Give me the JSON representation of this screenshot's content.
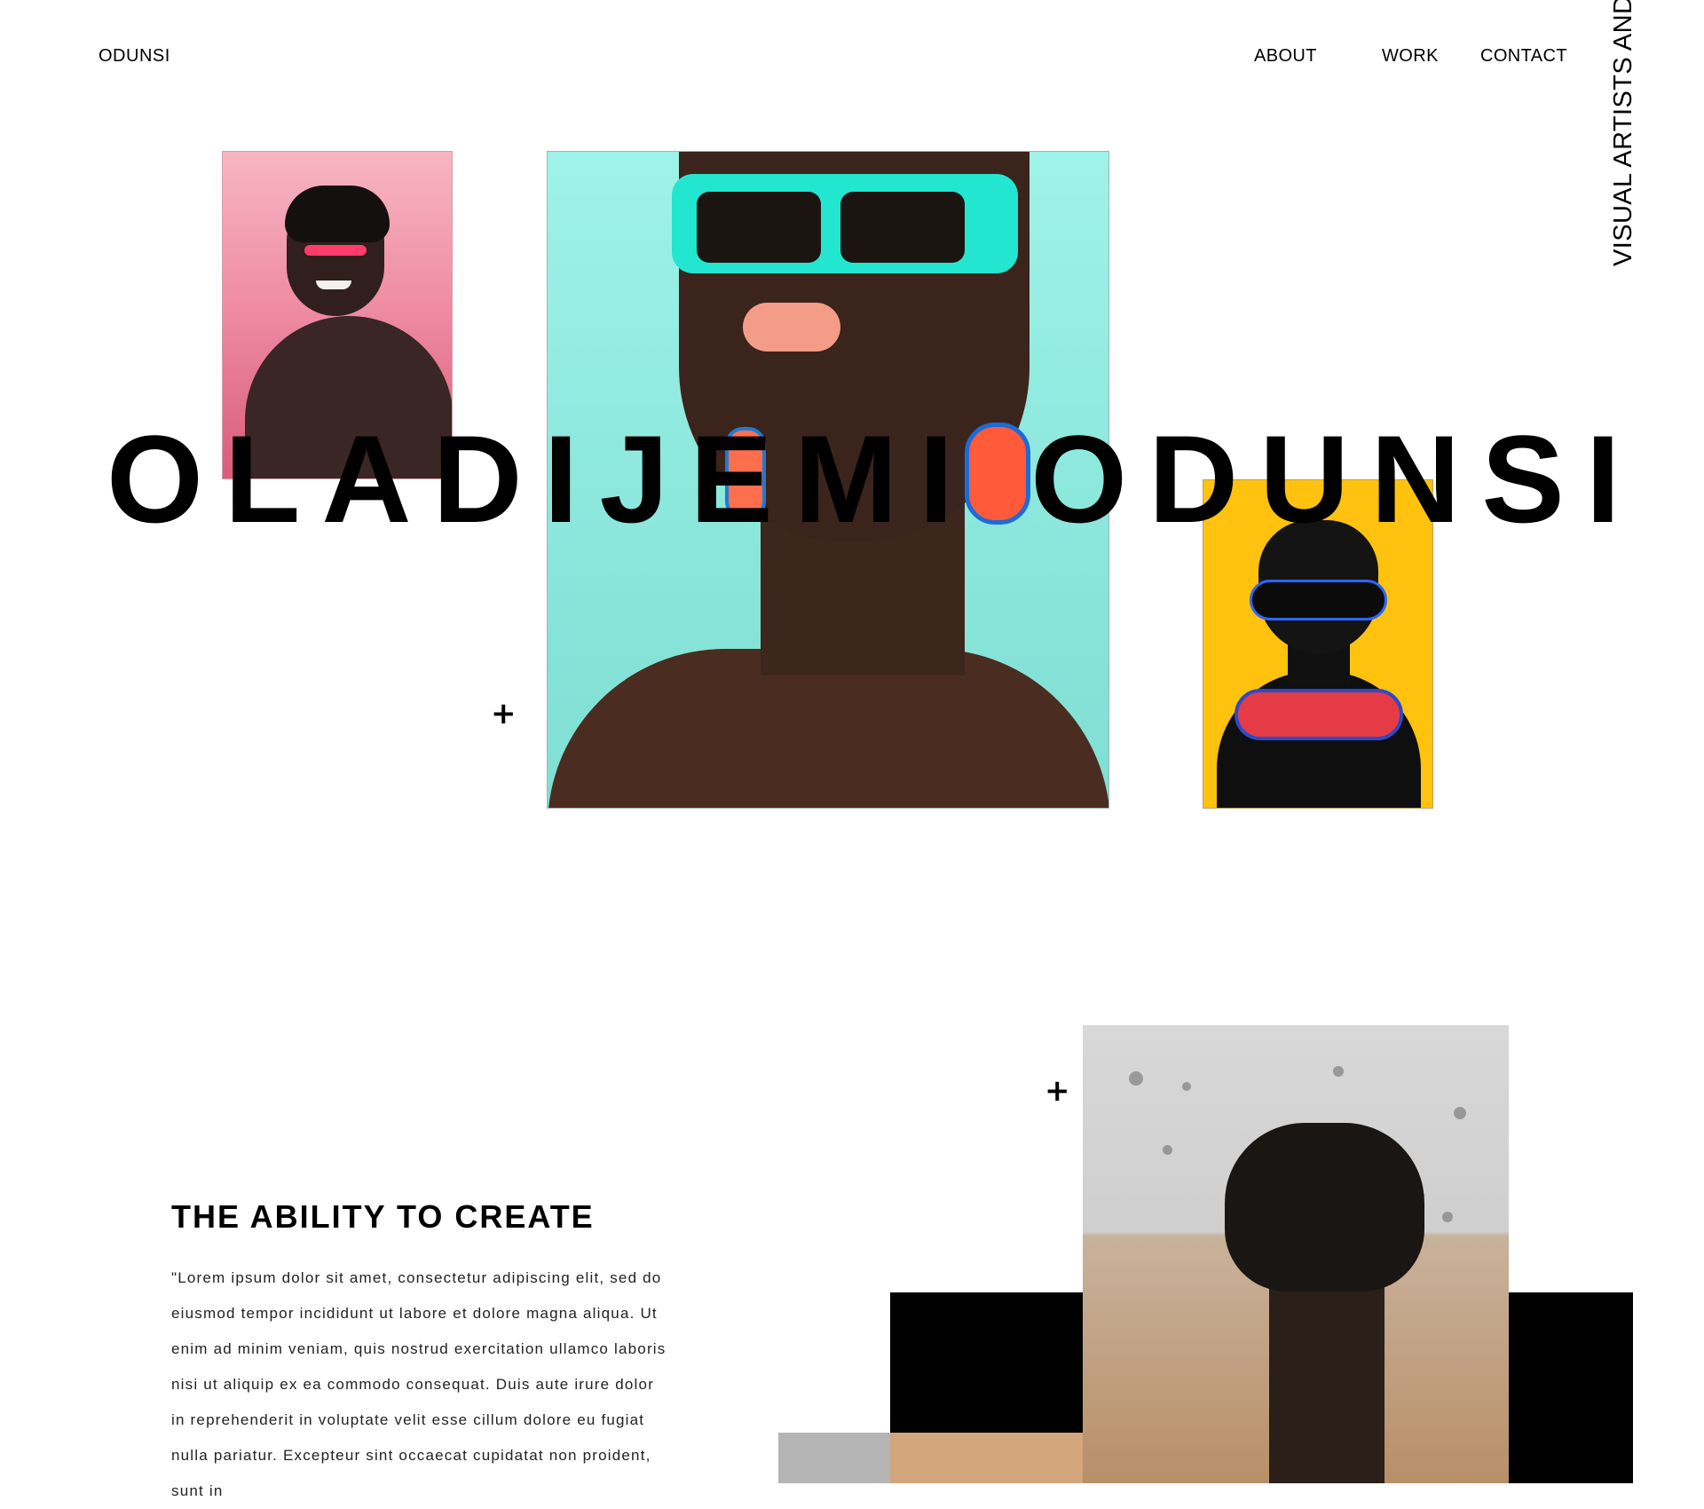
{
  "brand": "ODUNSI",
  "nav": {
    "about": "ABOUT",
    "work": "WORK",
    "contact": "CONTACT"
  },
  "hero": {
    "name": "OLADIJEMI ODUNSI",
    "tagline": "VISUAL ARTISTS AND PHOTOGRAPHER",
    "plus": "+"
  },
  "section": {
    "title": "THE ABILITY TO CREATE",
    "body": "\"Lorem ipsum dolor sit amet, consectetur adipiscing elit, sed do eiusmod tempor incididunt ut labore et dolore magna aliqua. Ut enim ad minim veniam, quis nostrud exercitation ullamco laboris nisi ut aliquip ex ea commodo consequat. Duis aute irure dolor in reprehenderit in voluptate velit esse cillum dolore eu fugiat nulla pariatur. Excepteur sint occaecat cupidatat non proident, sunt in"
  },
  "icons": {
    "plus_1": "plus-icon",
    "plus_2": "plus-icon"
  }
}
